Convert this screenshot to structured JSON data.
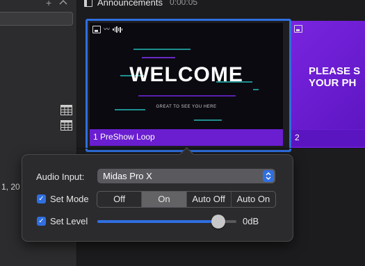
{
  "sidebar": {
    "date_fragment": "1, 20"
  },
  "header": {
    "title": "Announcements",
    "duration": "0:00:05"
  },
  "slides": [
    {
      "number_label": "1  PreShow Loop",
      "headline": "WELCOME",
      "subtitle": "GREAT TO SEE YOU HERE",
      "selected": true
    },
    {
      "number_label": "2",
      "headline_line1": "PLEASE S",
      "headline_line2": "YOUR PH"
    }
  ],
  "popover": {
    "audio_input_label": "Audio Input:",
    "audio_input_value": "Midas Pro X",
    "set_mode_label": "Set Mode",
    "set_mode_checked": true,
    "modes": [
      "Off",
      "On",
      "Auto Off",
      "Auto On"
    ],
    "active_mode": "On",
    "set_level_label": "Set Level",
    "set_level_checked": true,
    "level_fraction": 0.87,
    "level_value": "0dB"
  },
  "colors": {
    "accent": "#2f6fe0",
    "slide_purple": "#6a1ed0"
  }
}
